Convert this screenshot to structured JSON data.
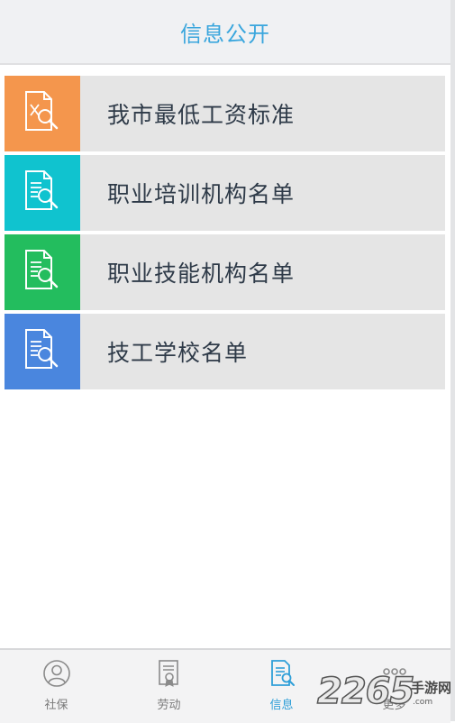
{
  "header": {
    "title": "信息公开"
  },
  "list": {
    "items": [
      {
        "label": "我市最低工资标准",
        "icon": "document-search-icon",
        "color": "#f4964d"
      },
      {
        "label": "职业培训机构名单",
        "icon": "document-search-icon",
        "color": "#10c3cf"
      },
      {
        "label": "职业技能机构名单",
        "icon": "document-search-icon",
        "color": "#23bd5e"
      },
      {
        "label": "技工学校名单",
        "icon": "document-search-icon",
        "color": "#4a86de"
      }
    ]
  },
  "tabbar": {
    "tabs": [
      {
        "label": "社保",
        "icon": "person-icon",
        "active": false
      },
      {
        "label": "劳动",
        "icon": "certificate-icon",
        "active": false
      },
      {
        "label": "信息",
        "icon": "document-search-icon",
        "active": true
      },
      {
        "label": "更多",
        "icon": "more-icon",
        "active": false
      }
    ]
  },
  "watermark": {
    "number": "2265",
    "text": "手游网",
    "url": ".com"
  },
  "colors": {
    "accent": "#3aa6dd",
    "tab_active": "#2f9fd8",
    "tab_inactive": "#7a7a7a"
  }
}
